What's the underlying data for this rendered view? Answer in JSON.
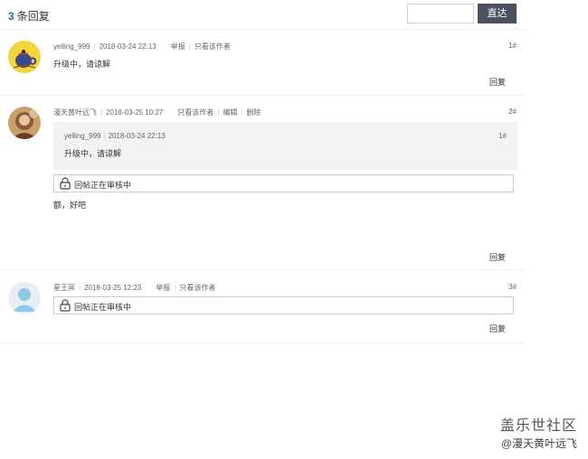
{
  "header": {
    "reply_count_number": "3",
    "reply_count_label": "条回复",
    "jump_input_value": "",
    "jump_button_label": "直达"
  },
  "posts": [
    {
      "username": "yelling_999",
      "datetime": "2018-03-24 22:13",
      "actions": [
        "举报",
        "只看该作者"
      ],
      "floor": "1#",
      "content": "升级中，请谅解",
      "reply_label": "回复"
    },
    {
      "username": "漫天黄叶远飞",
      "datetime": "2018-03-25 10:27",
      "actions": [
        "只看该作者",
        "编辑",
        "删除"
      ],
      "floor": "2#",
      "quote": {
        "username": "yelling_999",
        "datetime": "2018-03-24 22:13",
        "floor": "1#",
        "content": "升级中，请谅解"
      },
      "pending_notice": "回帖正在审核中",
      "content": "额，好吧",
      "reply_label": "回复"
    },
    {
      "username": "星王冥",
      "datetime": "2018-03-25 12:23",
      "actions": [
        "举报",
        "只看该作者"
      ],
      "floor": "3#",
      "pending_notice": "回帖正在审核中",
      "reply_label": "回复"
    }
  ],
  "watermark": {
    "title": "盖乐世社区",
    "subtitle": "@漫天黄叶远飞"
  },
  "colors": {
    "count_accent": "#1d6fb8",
    "button_bg": "#4a5260",
    "quote_bg": "#f2f2f2"
  }
}
